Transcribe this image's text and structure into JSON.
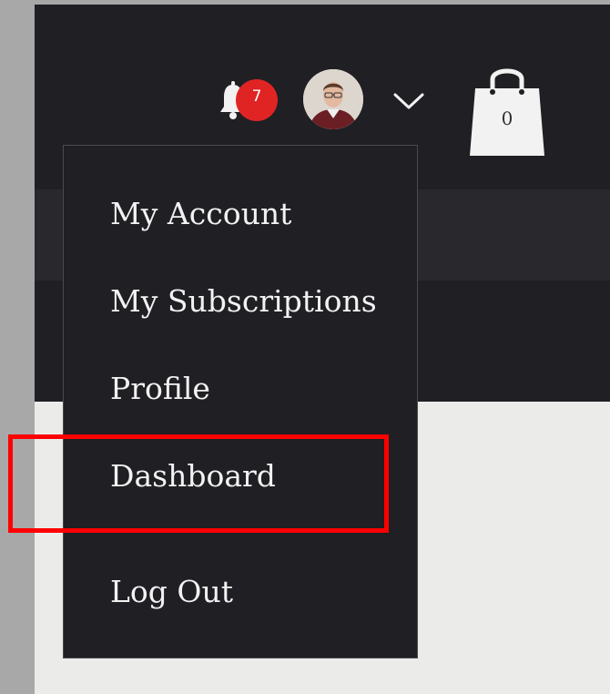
{
  "header": {
    "notifications": {
      "icon": "bell-icon",
      "count": "7"
    },
    "user": {
      "avatar_icon": "user-avatar",
      "dropdown_icon": "chevron-down-icon"
    },
    "cart": {
      "icon": "shopping-bag-icon",
      "count": "0"
    }
  },
  "user_menu": {
    "items": [
      {
        "label": "My Account"
      },
      {
        "label": "My Subscriptions"
      },
      {
        "label": "Profile"
      },
      {
        "label": "Dashboard"
      },
      {
        "label": "Log Out"
      }
    ]
  },
  "colors": {
    "header_bg": "#1f1f24",
    "menu_bg": "#1f1f24",
    "badge_red": "#e02424",
    "highlight_red": "#ff0000",
    "page_bg": "#ebecea"
  }
}
